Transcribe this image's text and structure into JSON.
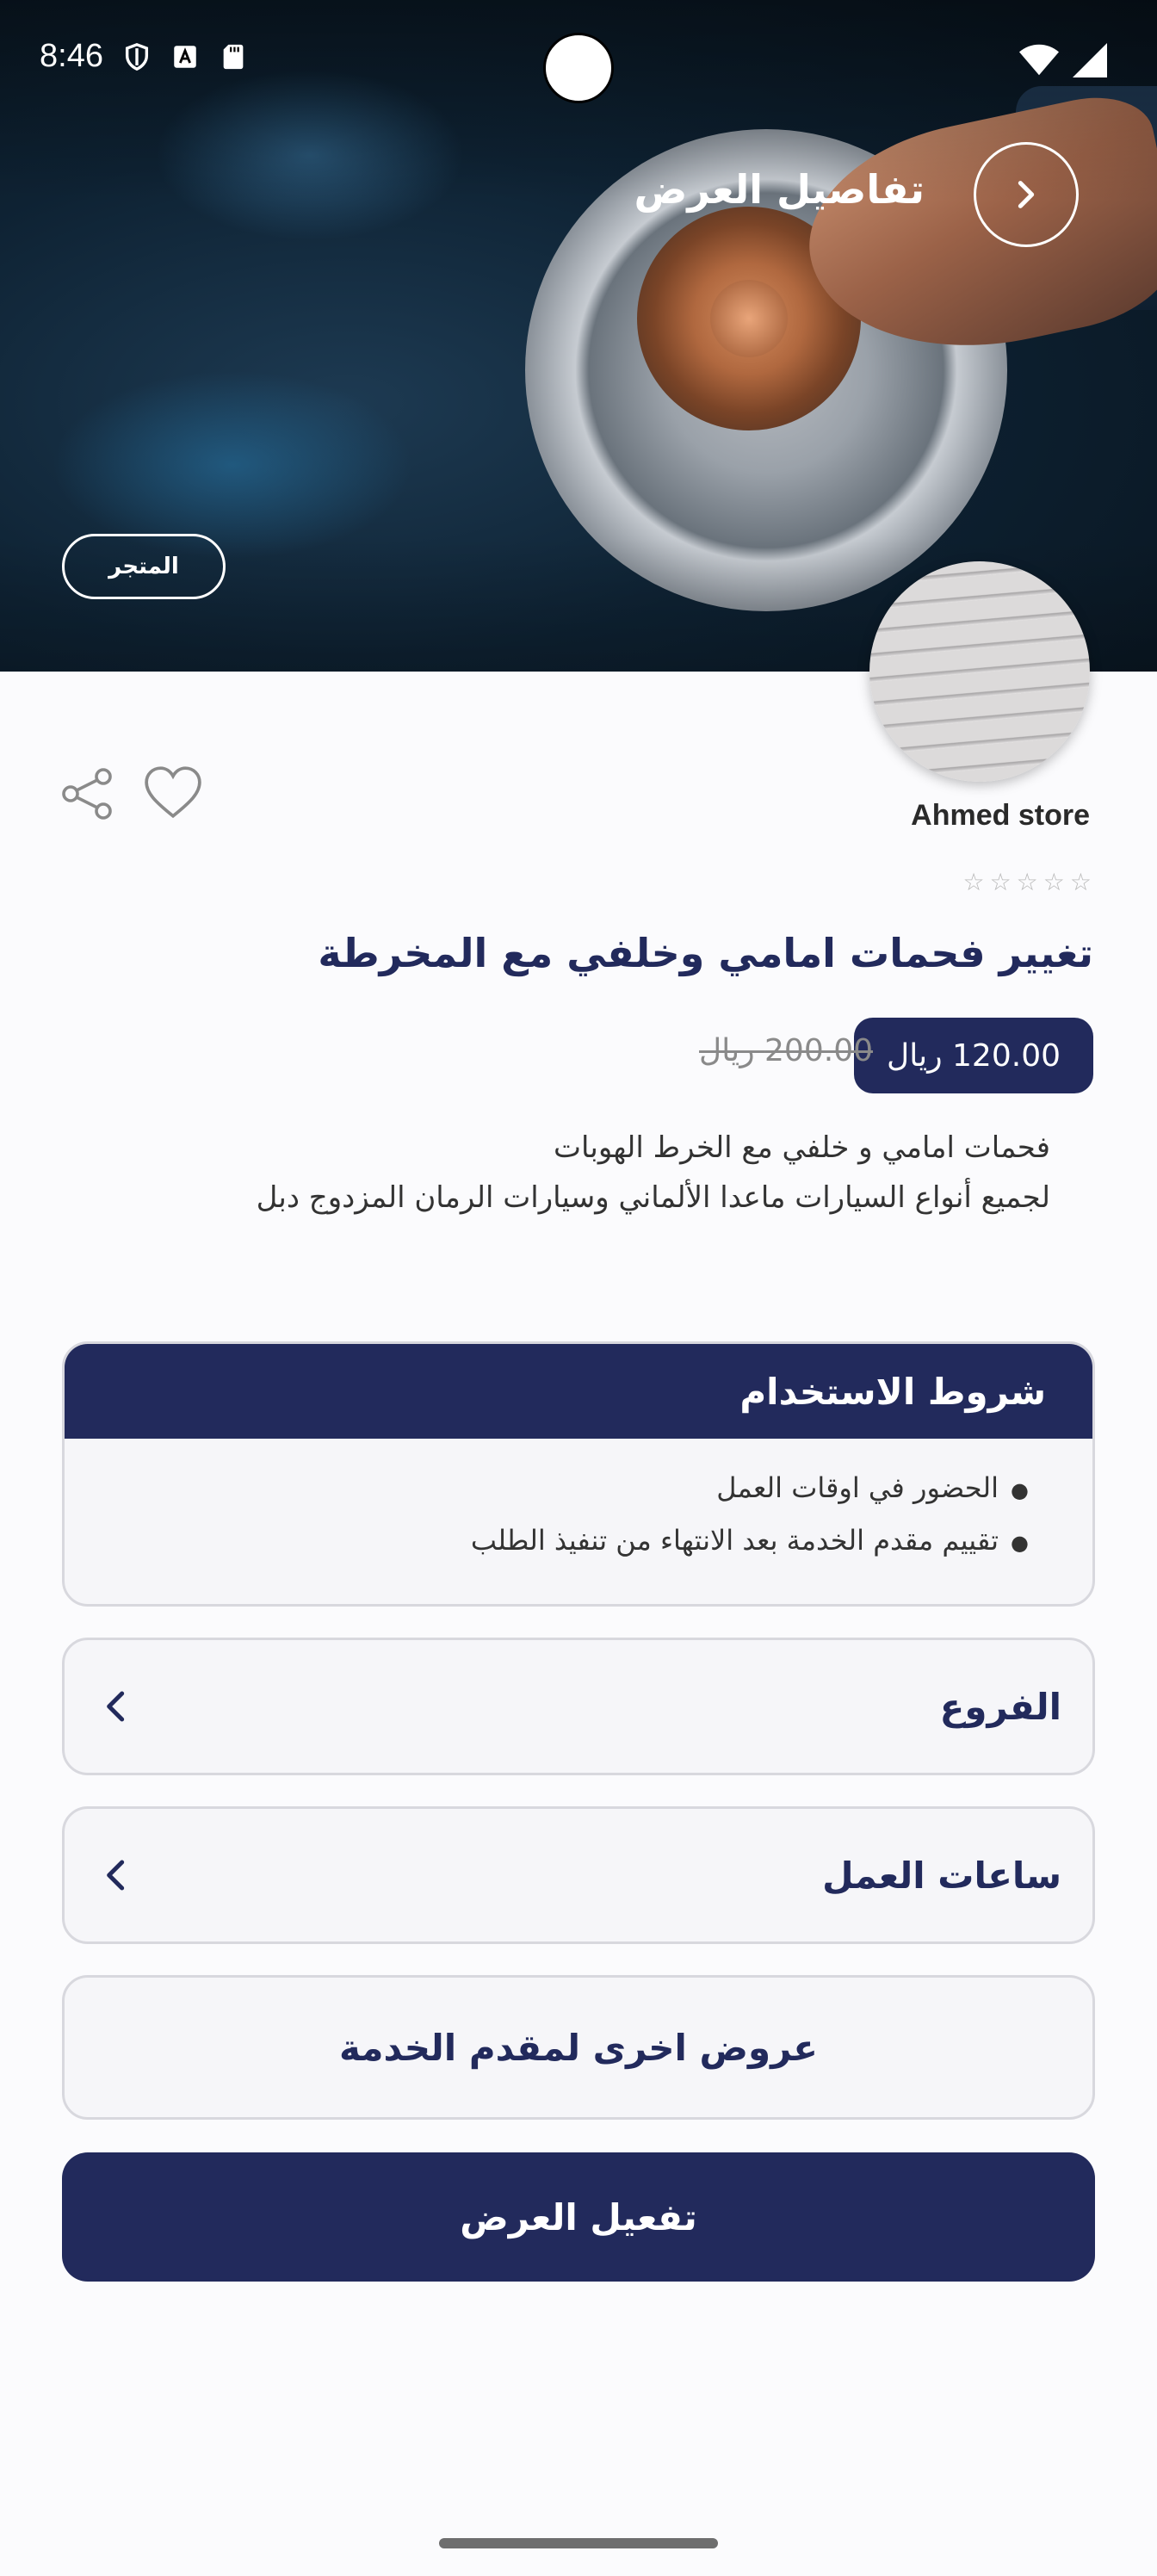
{
  "status_bar": {
    "time": "8:46"
  },
  "header": {
    "title": "تفاصيل العرض"
  },
  "store": {
    "store_link_label": "المتجر",
    "name": "Ahmed store",
    "rating": 0,
    "rating_max": 5
  },
  "offer": {
    "title": "تغيير فحمات امامي وخلفي مع المخرطة",
    "price": "120.00 ريال",
    "old_price": "200.00 ريال",
    "description_lines": [
      "فحمات امامي و خلفي مع الخرط الهوبات",
      "لجميع أنواع السيارات ماعدا الألماني  وسيارات الرمان المزدوج دبل"
    ]
  },
  "terms": {
    "heading": "شروط الاستخدام",
    "items": [
      "الحضور في اوقات العمل",
      "تقييم مقدم الخدمة بعد الانتهاء من تنفيذ الطلب"
    ]
  },
  "sections": {
    "branches_label": "الفروع",
    "hours_label": "ساعات العمل"
  },
  "actions": {
    "other_offers_label": "عروض اخرى لمقدم الخدمة",
    "activate_label": "تفعيل العرض"
  },
  "colors": {
    "primary": "#222a5c",
    "card_border": "#d8d8de"
  },
  "icons": {
    "back": "chevron-right-icon",
    "share": "share-icon",
    "favorite": "heart-icon",
    "row_chevron": "chevron-left-icon"
  }
}
